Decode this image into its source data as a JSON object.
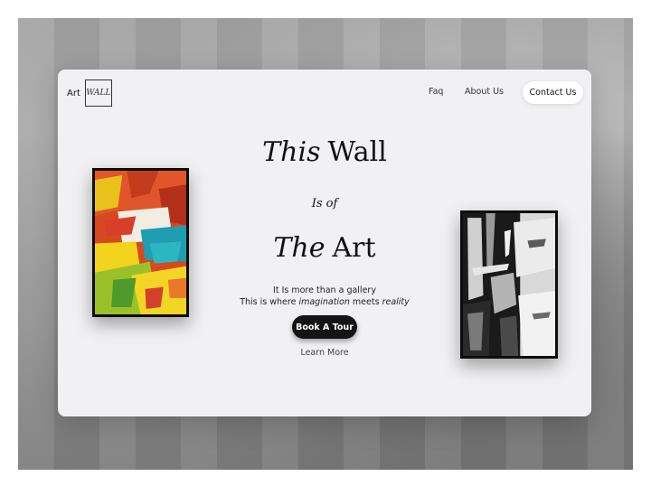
{
  "header": {
    "logo_text": "Art",
    "logo_box_text": "WALL",
    "nav": {
      "faq": "Faq",
      "about": "About Us",
      "contact": "Contact Us"
    }
  },
  "hero": {
    "line1_italic": "This",
    "line1_rest": "Wall",
    "line2": "Is of",
    "line3_italic": "The",
    "line3_rest": "Art",
    "sub1": "It Is more than a gallery",
    "sub2_a": "This is where ",
    "sub2_b": "imagination",
    "sub2_c": " meets ",
    "sub2_d": "reality",
    "cta": "Book A Tour",
    "secondary": "Learn More"
  },
  "colors": {
    "card_bg": "#f1f1f3",
    "cta_bg": "#141414",
    "frame": "#0d0d0d"
  }
}
